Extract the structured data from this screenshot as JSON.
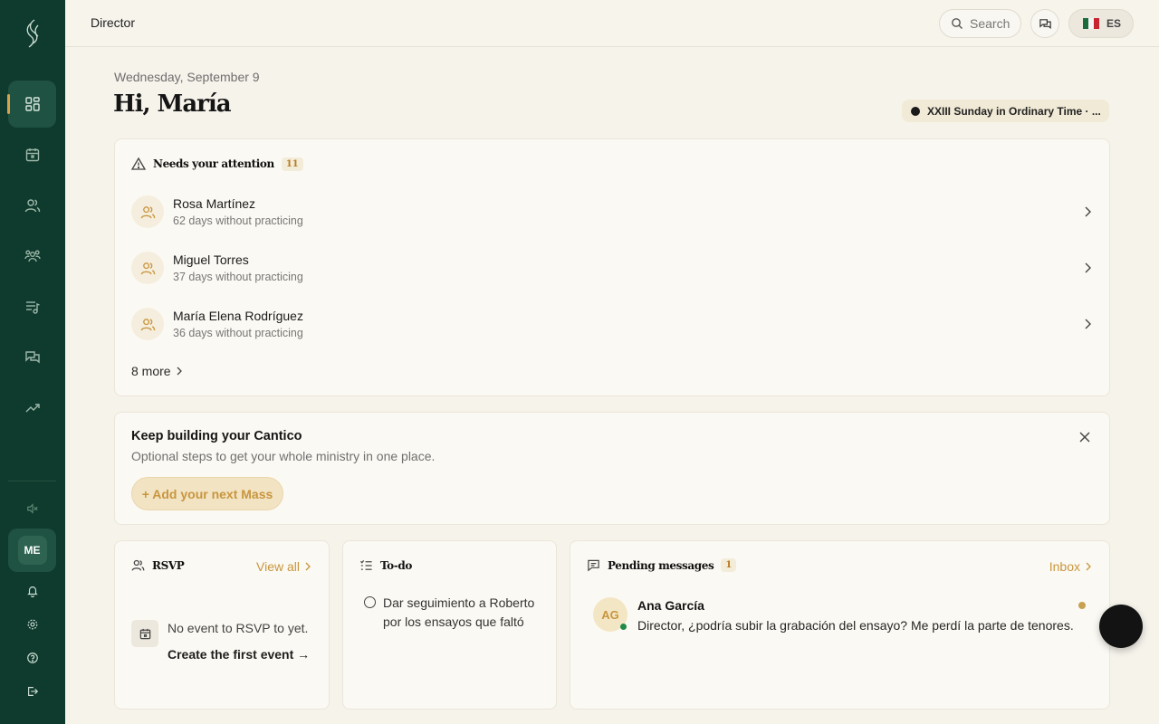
{
  "topbar": {
    "title": "Director",
    "search_label": "Search",
    "language": "ES"
  },
  "header": {
    "date": "Wednesday, September 9",
    "greeting": "Hi, María",
    "liturgical_day": "XXIII Sunday in Ordinary Time · ..."
  },
  "attention": {
    "title": "Needs your attention",
    "count": "11",
    "items": [
      {
        "name": "Rosa Martínez",
        "detail": "62 days without practicing"
      },
      {
        "name": "Miguel Torres",
        "detail": "37 days without practicing"
      },
      {
        "name": "María Elena Rodríguez",
        "detail": "36 days without practicing"
      }
    ],
    "more_label": "8 more"
  },
  "keep_building": {
    "title": "Keep building your Cantico",
    "subtitle": "Optional steps to get your whole ministry in one place.",
    "button_label": "+ Add your next Mass"
  },
  "rsvp": {
    "title": "RSVP",
    "view_all": "View all",
    "empty_text": "No event to RSVP to yet.",
    "create_link": "Create the first event →"
  },
  "todo": {
    "title": "To-do",
    "items": [
      {
        "text": "Dar seguimiento a Roberto por los ensayos que faltó"
      }
    ]
  },
  "messages": {
    "title": "Pending messages",
    "count": "1",
    "inbox_label": "Inbox",
    "items": [
      {
        "initials": "AG",
        "sender": "Ana García",
        "text": "Director, ¿podría subir la grabación del ensayo? Me perdí la parte de tenores."
      }
    ]
  },
  "sidebar": {
    "user_initials": "ME",
    "items": [
      "dashboard-icon",
      "calendar-icon",
      "members-icon",
      "groups-icon",
      "music-list-icon",
      "messages-icon",
      "trending-icon"
    ]
  },
  "colors": {
    "sidebar": "#0f3b2e",
    "accent": "#c8963e",
    "background": "#f6f3eb"
  }
}
